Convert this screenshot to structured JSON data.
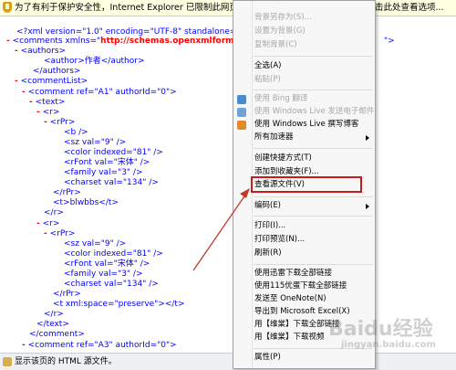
{
  "infobar": {
    "text_left": "为了有利于保护安全性，Internet Explorer 已限制此网页运行可以访",
    "text_right": "击此处查看选项..."
  },
  "xml": {
    "decl": "<?xml version=\"1.0\" encoding=\"UTF-8\" standalone=\"yes",
    "comments_open_a": "<comments xmlns=\"",
    "comments_ns": "http://schemas.openxmlformat",
    "comments_tail": "\">",
    "authors_open": "<authors>",
    "author_line": "<author>作者</author>",
    "authors_close": "</authors>",
    "commentList_open": "<commentList>",
    "comment_a1_open": "<comment ref=\"A1\" authorId=\"0\">",
    "text_open": "<text>",
    "r_open": "<r>",
    "rPr_open": "<rPr>",
    "b_tag": "<b />",
    "sz_tag": "<sz val=\"9\" />",
    "color_tag": "<color indexed=\"81\" />",
    "rFont_tag": "<rFont val=\"宋体\" />",
    "family_tag": "<family val=\"3\" />",
    "charset_tag": "<charset val=\"134\" />",
    "rPr_close": "</rPr>",
    "t_blwbbs": "<t>blwbbs</t>",
    "r_close": "</r>",
    "t_preserve": "<t xml:space=\"preserve\"></t>",
    "text_close": "</text>",
    "comment_close": "</comment>",
    "comment_a3_open": "<comment ref=\"A3\" authorId=\"0\">",
    "minus": "-"
  },
  "statusbar": {
    "text": "显示该页的 HTML 源文件。"
  },
  "menu": {
    "items": [
      {
        "label": "背景另存为(S)...",
        "disabled": true
      },
      {
        "label": "设置为背景(G)",
        "disabled": true
      },
      {
        "label": "复制背景(C)",
        "disabled": true
      },
      {
        "label": "全选(A)",
        "disabled": false
      },
      {
        "label": "粘贴(P)",
        "disabled": true
      },
      {
        "label": "使用 Bing 翻译",
        "disabled": true
      },
      {
        "label": "使用 Windows Live 发送电子邮件",
        "disabled": true
      },
      {
        "label": "使用 Windows Live 撰写博客",
        "disabled": false
      },
      {
        "label": "所有加速器",
        "disabled": false
      },
      {
        "label": "创建快捷方式(T)",
        "disabled": false
      },
      {
        "label": "添加到收藏夹(F)...",
        "disabled": false
      },
      {
        "label": "查看源文件(V)",
        "disabled": false
      },
      {
        "label": "编码(E)",
        "disabled": false
      },
      {
        "label": "打印(I)...",
        "disabled": false
      },
      {
        "label": "打印预览(N)...",
        "disabled": false
      },
      {
        "label": "刷新(R)",
        "disabled": false
      },
      {
        "label": "使用迅雷下载全部链接",
        "disabled": false
      },
      {
        "label": "使用115优蛋下载全部链接",
        "disabled": false
      },
      {
        "label": "发送至 OneNote(N)",
        "disabled": false
      },
      {
        "label": "导出到 Microsoft Excel(X)",
        "disabled": false
      },
      {
        "label": "用【维棠】下载全部链接",
        "disabled": false
      },
      {
        "label": "用【维棠】下载视频",
        "disabled": false
      },
      {
        "label": "属性(P)",
        "disabled": false
      }
    ]
  },
  "watermark": {
    "main": "Baidu经验",
    "url": "jingyan.baidu.com"
  },
  "colors": {
    "highlight_box": "#cc1a1a",
    "arrow": "#c0392b",
    "infobar_bg": "#ffffe1"
  }
}
